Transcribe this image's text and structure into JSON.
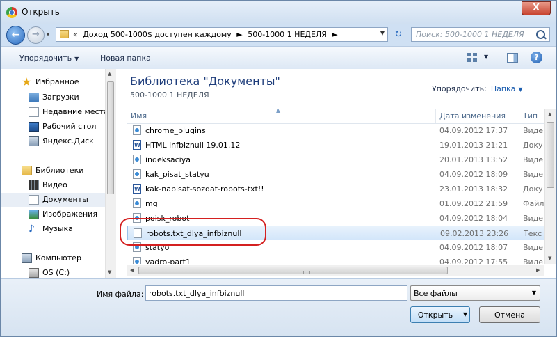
{
  "window": {
    "title": "Открыть",
    "close_label": "X"
  },
  "nav": {
    "back_label": "←",
    "forward_label": "→",
    "history_label": "▾"
  },
  "address": {
    "prefix": "«",
    "segments": [
      "Доход 500-1000$ доступен каждому",
      "►",
      "500-1000 1 НЕДЕЛЯ",
      "►"
    ],
    "dropdown": "▼"
  },
  "refresh_label": "↻",
  "search": {
    "placeholder": "Поиск: 500-1000 1 НЕДЕЛЯ"
  },
  "toolbar": {
    "organize_label": "Упорядочить",
    "organize_arrow": "▼",
    "new_folder_label": "Новая папка",
    "view_arrow": "▼",
    "help_label": "?"
  },
  "sidebar": {
    "items": [
      {
        "label": "Избранное",
        "icon": "star-icon"
      },
      {
        "label": "Загрузки",
        "icon": "downloads-icon"
      },
      {
        "label": "Недавние места",
        "icon": "recent-places-icon"
      },
      {
        "label": "Рабочий стол",
        "icon": "desktop-icon"
      },
      {
        "label": "Яндекс.Диск",
        "icon": "yandex-disk-icon"
      },
      {
        "label": "Библиотеки",
        "icon": "libraries-icon"
      },
      {
        "label": "Видео",
        "icon": "video-icon"
      },
      {
        "label": "Документы",
        "icon": "documents-icon"
      },
      {
        "label": "Изображения",
        "icon": "pictures-icon"
      },
      {
        "label": "Музыка",
        "icon": "music-icon"
      },
      {
        "label": "Компьютер",
        "icon": "computer-icon"
      },
      {
        "label": "OS (C:)",
        "icon": "drive-icon"
      }
    ],
    "selected": "Документы"
  },
  "main": {
    "library_title": "Библиотека \"Документы\"",
    "library_subtitle": "500-1000 1 НЕДЕЛЯ",
    "arrange_label": "Упорядочить:",
    "arrange_value": "Папка",
    "arrange_arrow": "▼",
    "sort_caret": "▲",
    "columns": {
      "name": "Имя",
      "date": "Дата изменения",
      "type": "Тип"
    },
    "files": [
      {
        "name": "chrome_plugins",
        "date": "04.09.2012 17:37",
        "type": "Виде",
        "icon": "html-file-icon"
      },
      {
        "name": "HTML infbiznull 19.01.12",
        "date": "19.01.2013 21:21",
        "type": "Доку",
        "icon": "word-file-icon"
      },
      {
        "name": "indeksaciya",
        "date": "20.01.2013 13:52",
        "type": "Виде",
        "icon": "html-file-icon"
      },
      {
        "name": "kak_pisat_statyu",
        "date": "04.09.2012 18:09",
        "type": "Виде",
        "icon": "html-file-icon"
      },
      {
        "name": "kak-napisat-sozdat-robots-txt!!",
        "date": "23.01.2013 18:32",
        "type": "Доку",
        "icon": "word-file-icon"
      },
      {
        "name": "mg",
        "date": "01.09.2012 21:59",
        "type": "Файл",
        "icon": "html-file-icon"
      },
      {
        "name": "poisk_robot",
        "date": "04.09.2012 18:04",
        "type": "Виде",
        "icon": "html-file-icon"
      },
      {
        "name": "robots.txt_dlya_infbiznull",
        "date": "09.02.2013 23:26",
        "type": "Текс",
        "icon": "text-file-icon",
        "selected": true
      },
      {
        "name": "statyo",
        "date": "04.09.2012 18:07",
        "type": "Виде",
        "icon": "html-file-icon"
      },
      {
        "name": "yadro-part1",
        "date": "04.09.2012 17:55",
        "type": "Виде",
        "icon": "html-file-icon"
      }
    ]
  },
  "bottom": {
    "filename_label": "Имя файла:",
    "filename_value": "robots.txt_dlya_infbiznull",
    "filetype_value": "Все файлы",
    "filetype_arrow": "▼",
    "open_label": "Открыть",
    "open_arrow": "▼",
    "cancel_label": "Отмена"
  },
  "colors": {
    "title_blue": "#1e3d7b",
    "selection": "#d3e6fa",
    "highlight_ellipse": "#d42020"
  }
}
